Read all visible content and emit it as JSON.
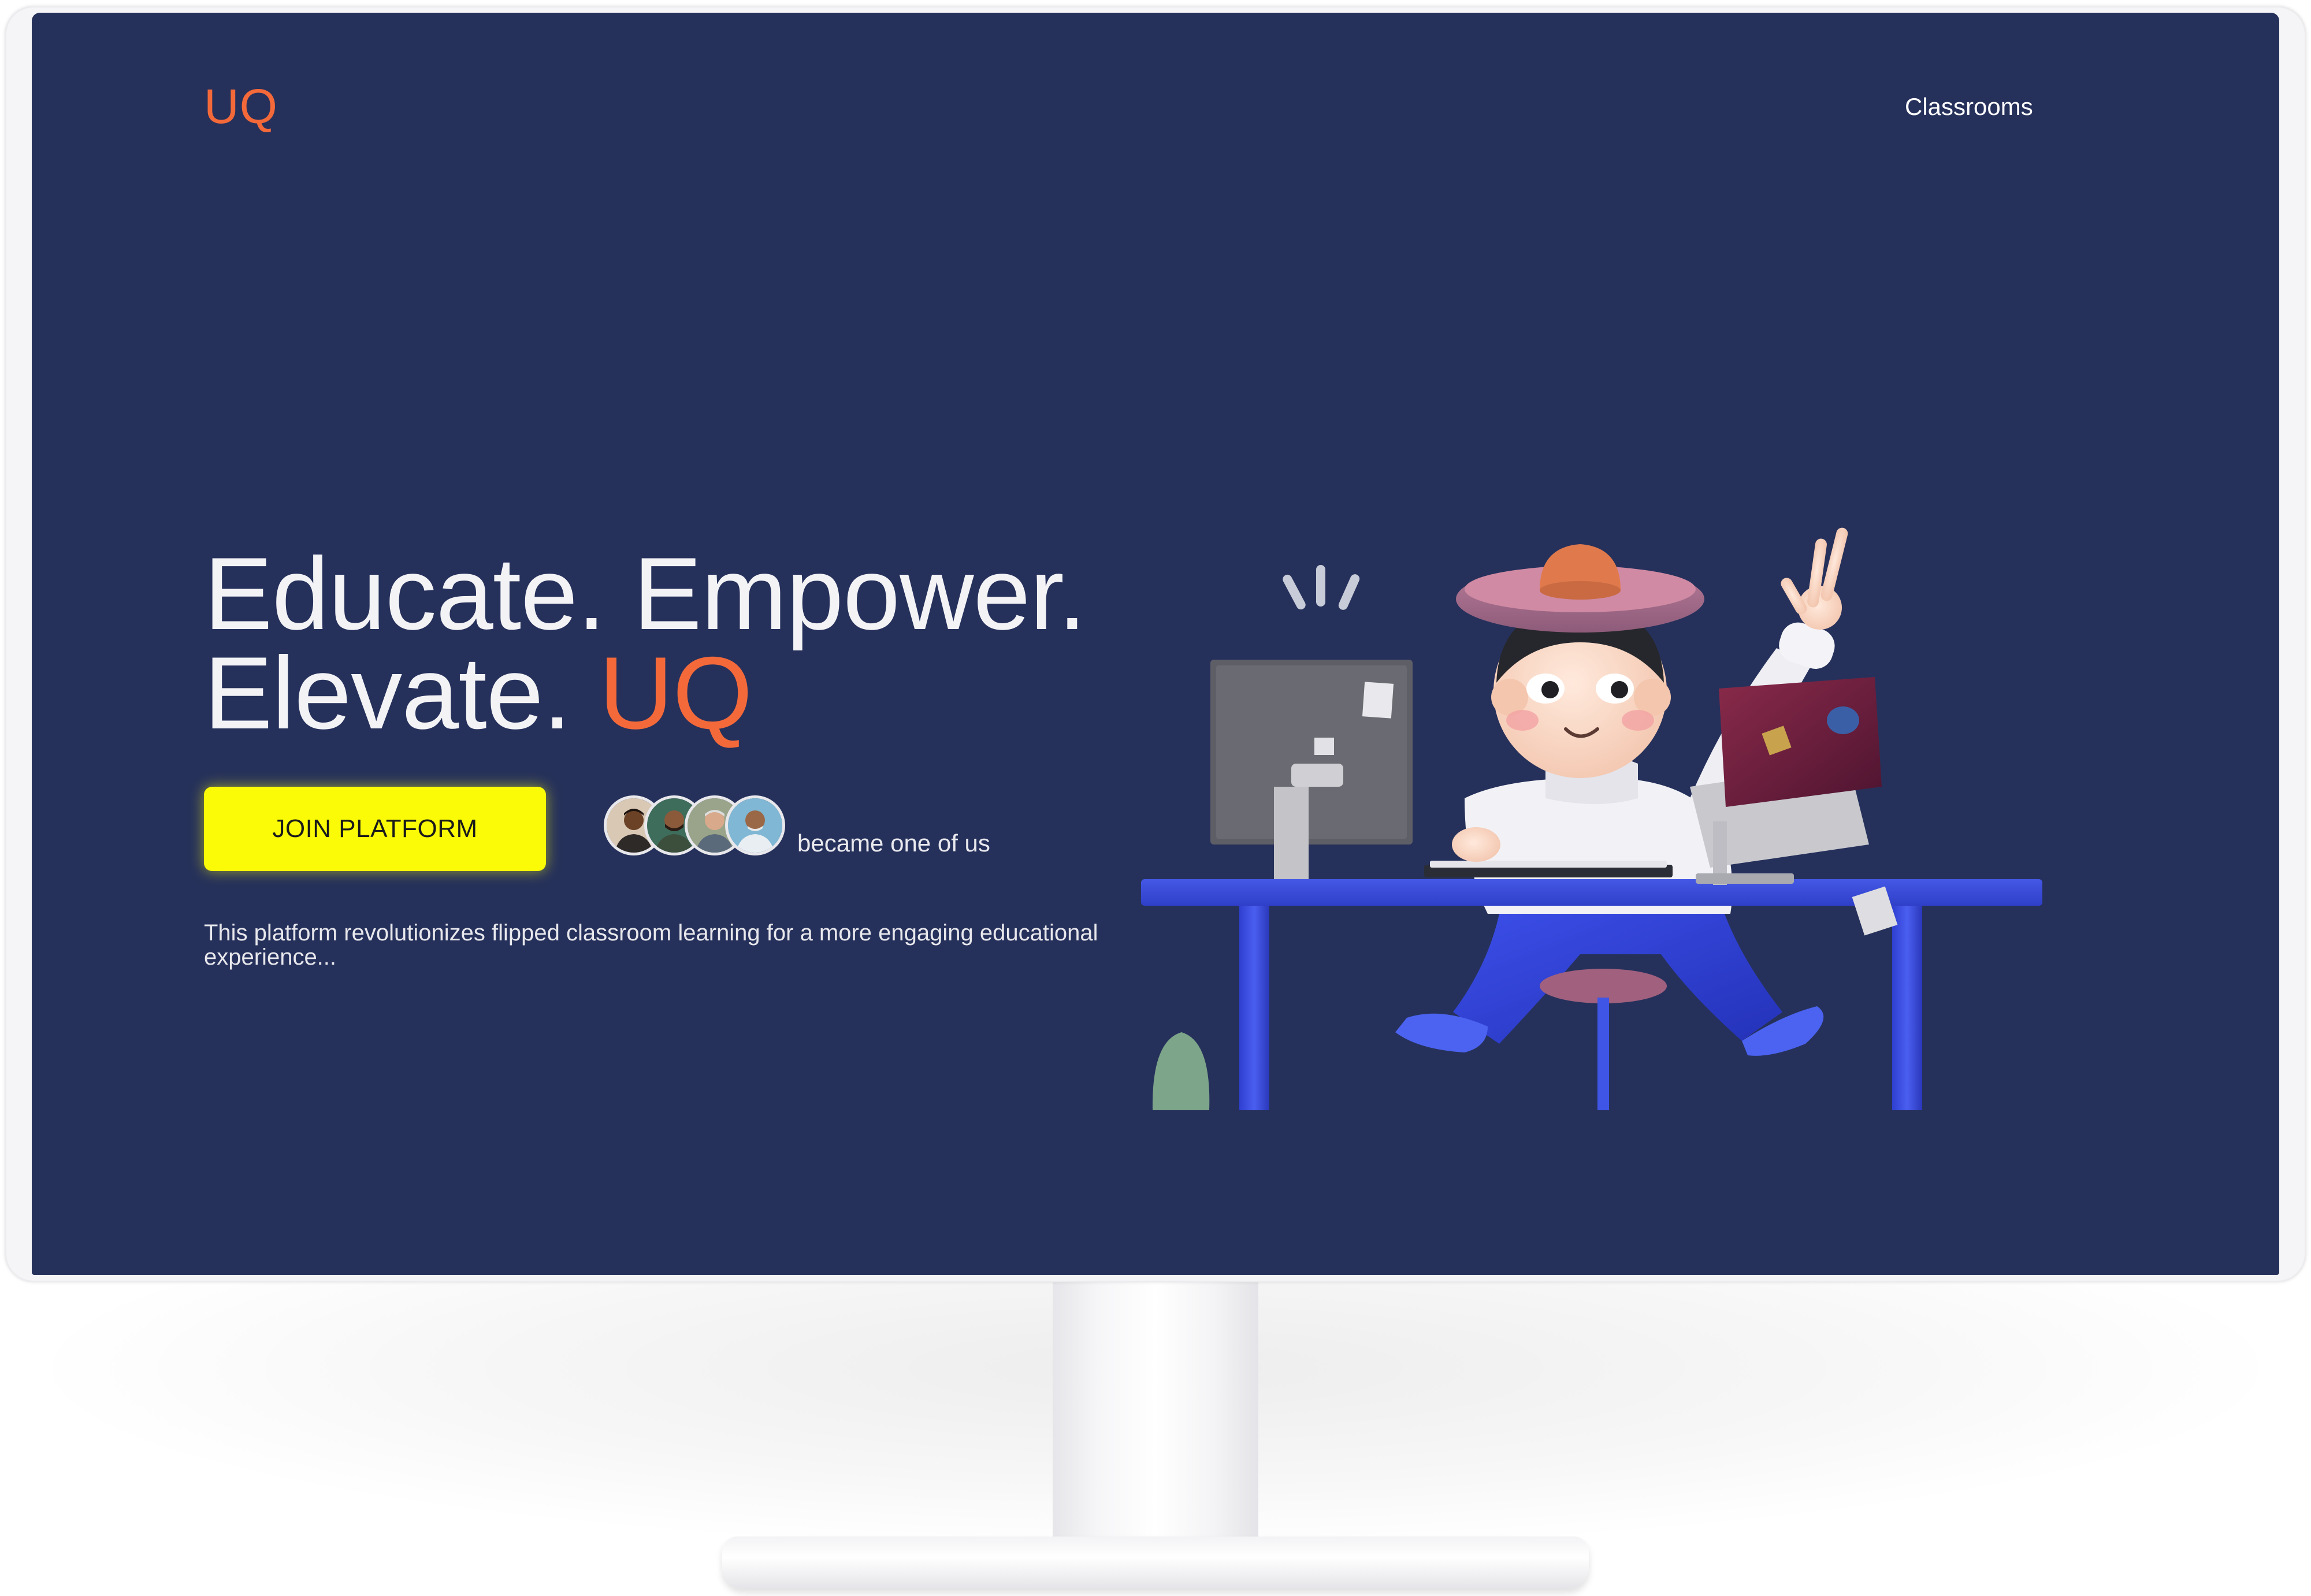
{
  "header": {
    "logo": "UQ",
    "nav": [
      {
        "label": "Classrooms"
      }
    ]
  },
  "hero": {
    "headline_line1": "Educate. Empower.",
    "headline_line2_prefix": "Elevate.",
    "headline_accent": "UQ",
    "cta_label": "JOIN PLATFORM",
    "members_caption": "became one of us",
    "member_avatars": 4,
    "description": "This platform revolutionizes flipped classroom learning for a more engaging educational experience..."
  },
  "colors": {
    "background": "#26315b",
    "accent": "#f4693a",
    "cta_background": "#fbfb08",
    "text": "#f3f3f6"
  },
  "icons": [
    "member-avatar",
    "student-at-desk-illustration"
  ]
}
